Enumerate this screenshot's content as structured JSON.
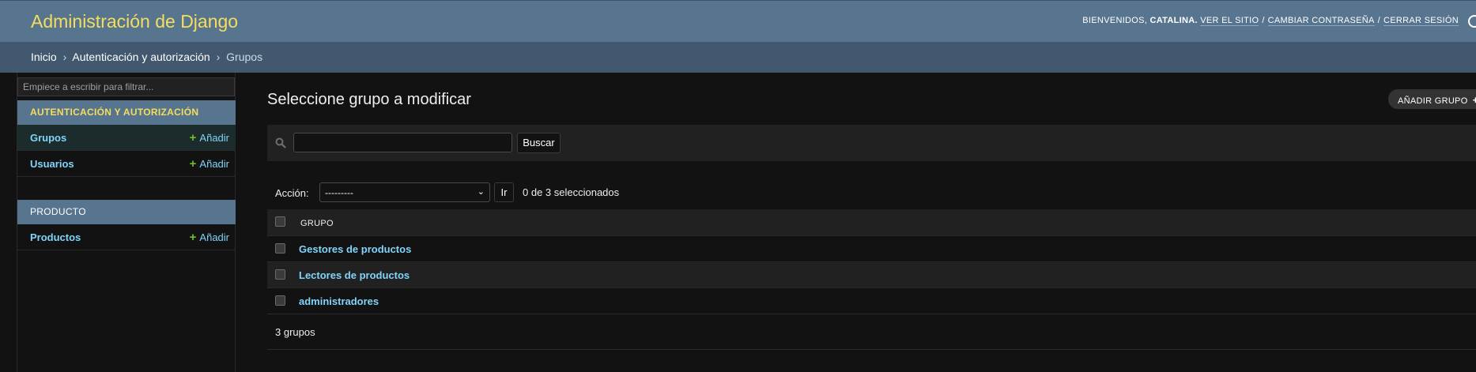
{
  "header": {
    "branding": "Administración de Django",
    "welcome": "BIENVENIDOS,",
    "username": "CATALINA.",
    "view_site": "VER EL SITIO",
    "change_password": "CAMBIAR CONTRASEÑA",
    "logout": "CERRAR SESIÓN",
    "separator": "/"
  },
  "breadcrumbs": {
    "home": "Inicio",
    "app": "Autenticación y autorización",
    "current": "Grupos",
    "arrow": "›"
  },
  "sidebar": {
    "filter_placeholder": "Empiece a escribir para filtrar...",
    "apps": [
      {
        "caption": "AUTENTICACIÓN Y AUTORIZACIÓN",
        "models": [
          {
            "name": "Grupos",
            "add": "Añadir"
          },
          {
            "name": "Usuarios",
            "add": "Añadir"
          }
        ]
      },
      {
        "caption": "PRODUCTO",
        "models": [
          {
            "name": "Productos",
            "add": "Añadir"
          }
        ]
      }
    ]
  },
  "content": {
    "title": "Seleccione grupo a modificar",
    "add_button": "AÑADIR GRUPO",
    "search": {
      "value": "",
      "button": "Buscar"
    },
    "actions": {
      "label": "Acción:",
      "selected_option": "---------",
      "go": "Ir",
      "counter": "0 de 3 seleccionados"
    },
    "table": {
      "header": "GRUPO",
      "rows": [
        "Gestores de productos",
        "Lectores de productos",
        "administradores"
      ]
    },
    "paginator": "3 grupos"
  },
  "colors": {
    "header_bg": "#587590",
    "branding": "#f5dd5d",
    "link": "#81d4fa",
    "add_plus": "#70bf2b",
    "background": "#121212"
  },
  "icons": [
    "search-icon",
    "plus-icon",
    "chevron-down-icon",
    "theme-toggle-icon"
  ]
}
